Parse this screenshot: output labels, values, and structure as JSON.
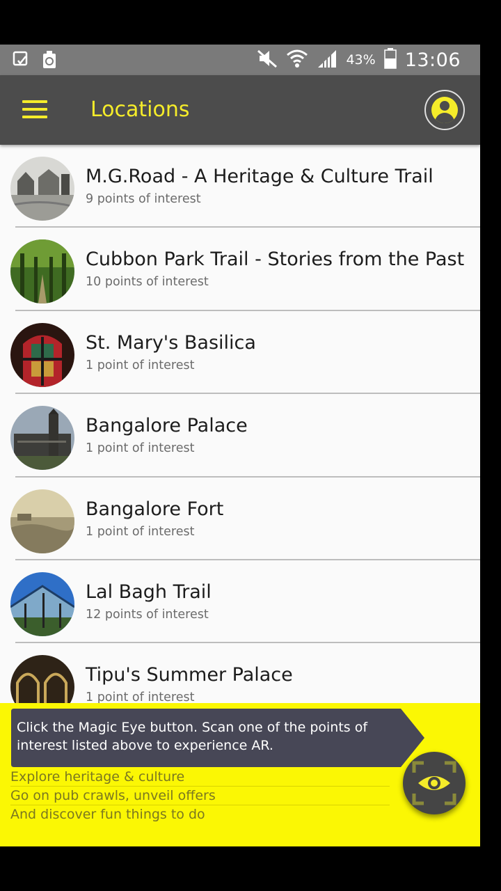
{
  "status_bar": {
    "battery": "43%",
    "time": "13:06"
  },
  "app_bar": {
    "title": "Locations"
  },
  "locations": [
    {
      "title": "M.G.Road - A Heritage & Culture Trail",
      "subtitle": "9 points of interest"
    },
    {
      "title": "Cubbon Park Trail - Stories from the Past",
      "subtitle": "10 points of interest"
    },
    {
      "title": "St. Mary's Basilica",
      "subtitle": "1 point of interest"
    },
    {
      "title": "Bangalore Palace",
      "subtitle": "1 point of interest"
    },
    {
      "title": "Bangalore Fort",
      "subtitle": "1 point of interest"
    },
    {
      "title": "Lal Bagh Trail",
      "subtitle": "12 points of interest"
    },
    {
      "title": "Tipu's Summer Palace",
      "subtitle": "1 point of interest"
    }
  ],
  "bottom_panel": {
    "tip": "Click the Magic Eye button. Scan one of the points of interest listed above to experience AR.",
    "promo_lines": [
      "Explore heritage & culture",
      "Go on pub crawls, unveil offers",
      "And discover fun things to do"
    ]
  },
  "colors": {
    "accent": "#f5ec2a",
    "app_bar": "#4c4c4c",
    "panel": "#fbf704",
    "tip_bubble": "#474756"
  },
  "icons": {
    "menu": "hamburger-menu-icon",
    "profile": "user-profile-icon",
    "magic_eye": "eye-icon",
    "status": [
      "notification-icon",
      "recycle-icon",
      "mute-icon",
      "wifi-icon",
      "signal-icon",
      "battery-icon"
    ]
  }
}
